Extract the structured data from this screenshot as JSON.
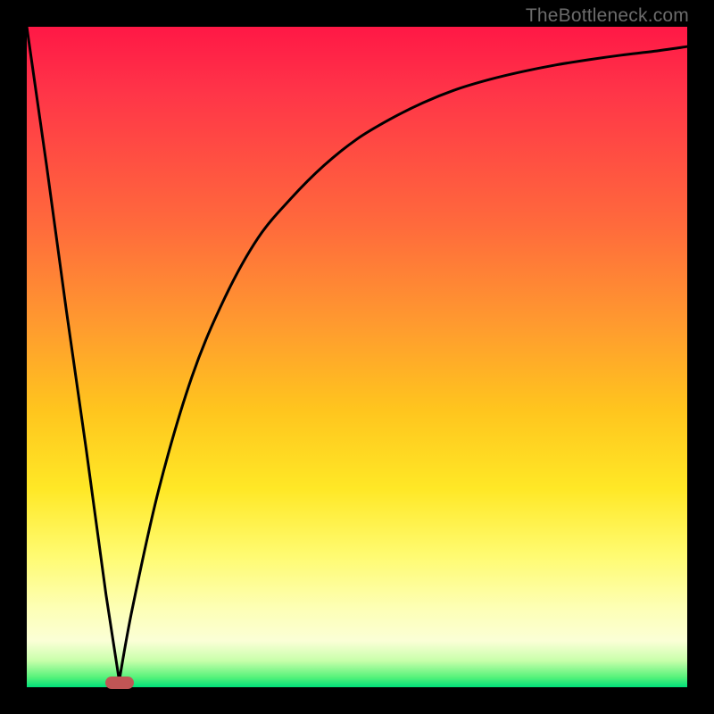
{
  "watermark": "TheBottleneck.com",
  "chart_data": {
    "type": "line",
    "title": "",
    "xlabel": "",
    "ylabel": "",
    "xlim": [
      0,
      100
    ],
    "ylim": [
      0,
      100
    ],
    "grid": false,
    "notes": "Background is a vertical gradient from red (high bottleneck) through orange/yellow to green (no bottleneck) at the bottom. A single black curve plunges from top-left to a sharp minimum near x≈14 at y≈0, then rises with decreasing slope toward the top-right. A small rounded red marker sits at the minimum.",
    "series": [
      {
        "name": "bottleneck-curve",
        "x": [
          0,
          3,
          6,
          9,
          12,
          14,
          16,
          20,
          25,
          30,
          35,
          40,
          45,
          50,
          55,
          60,
          65,
          70,
          75,
          80,
          85,
          90,
          95,
          100
        ],
        "y": [
          100,
          79,
          57,
          36,
          14,
          1,
          12,
          30,
          47,
          59,
          68,
          74,
          79,
          83,
          86,
          88.5,
          90.5,
          92,
          93.2,
          94.2,
          95,
          95.7,
          96.3,
          97
        ]
      }
    ],
    "marker": {
      "x": 14,
      "y": 0.5,
      "shape": "rounded-pill",
      "color": "#c05555"
    }
  },
  "colors": {
    "curve": "#000000",
    "frame": "#000000",
    "gradient_top": "#ff1846",
    "gradient_bottom": "#00e07a",
    "marker": "#c05555",
    "watermark": "#6b6b6b"
  }
}
